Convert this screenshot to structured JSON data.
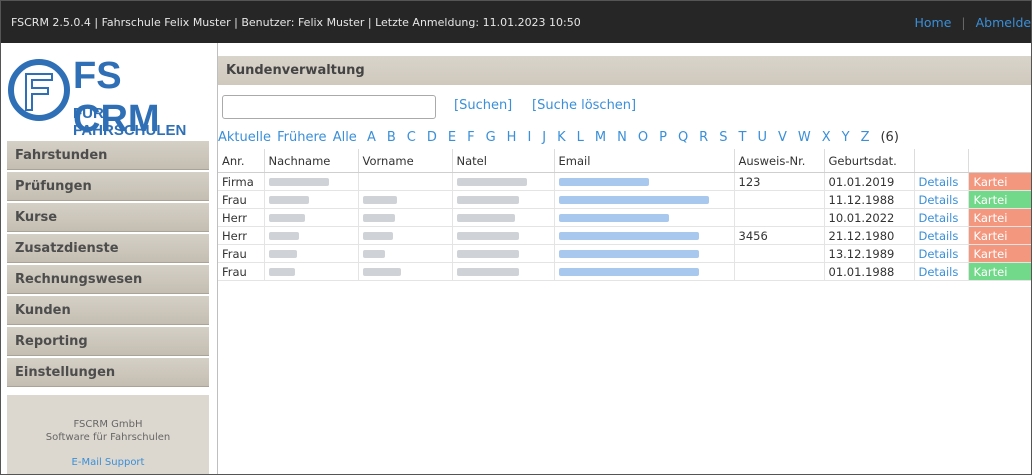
{
  "topbar": {
    "info": "FSCRM 2.5.0.4 | Fahrschule Felix Muster | Benutzer: Felix Muster | Letzte Anmeldung: 11.01.2023 10:50",
    "home": "Home",
    "logout": "Abmelden"
  },
  "logo": {
    "big": "FS CRM",
    "small": "FÜR FAHRSCHULEN",
    "colors": {
      "brand": "#2f6fb5"
    }
  },
  "nav": [
    "Fahrstunden",
    "Prüfungen",
    "Kurse",
    "Zusatzdienste",
    "Rechnungswesen",
    "Kunden",
    "Reporting",
    "Einstellungen"
  ],
  "footer": {
    "company": "FSCRM GmbH",
    "tagline": "Software für Fahrschulen",
    "support": "E-Mail Support"
  },
  "main": {
    "title": "Kundenverwaltung",
    "search": {
      "value": "",
      "placeholder": ""
    },
    "search_button": "[Suchen]",
    "clear_button": "[Suche löschen]",
    "filters": [
      "Aktuelle",
      "Frühere",
      "Alle"
    ],
    "letters": [
      "A",
      "B",
      "C",
      "D",
      "E",
      "F",
      "G",
      "H",
      "I",
      "J",
      "K",
      "L",
      "M",
      "N",
      "O",
      "P",
      "Q",
      "R",
      "S",
      "T",
      "U",
      "V",
      "W",
      "X",
      "Y",
      "Z"
    ],
    "count": "(6)"
  },
  "table": {
    "columns": [
      "Anr.",
      "Nachname",
      "Vorname",
      "Natel",
      "Email",
      "Ausweis-Nr.",
      "Geburtsdat.",
      "",
      ""
    ],
    "rows": [
      {
        "anr": "Firma",
        "ausweis": "123",
        "geburt": "01.01.2019",
        "details": "Details",
        "kartei": "Kartei",
        "kartei_status": "red"
      },
      {
        "anr": "Frau",
        "ausweis": "",
        "geburt": "11.12.1988",
        "details": "Details",
        "kartei": "Kartei",
        "kartei_status": "green"
      },
      {
        "anr": "Herr",
        "ausweis": "",
        "geburt": "10.01.2022",
        "details": "Details",
        "kartei": "Kartei",
        "kartei_status": "red"
      },
      {
        "anr": "Herr",
        "ausweis": "3456",
        "geburt": "21.12.1980",
        "details": "Details",
        "kartei": "Kartei",
        "kartei_status": "red"
      },
      {
        "anr": "Frau",
        "ausweis": "",
        "geburt": "13.12.1989",
        "details": "Details",
        "kartei": "Kartei",
        "kartei_status": "red"
      },
      {
        "anr": "Frau",
        "ausweis": "",
        "geburt": "01.01.1988",
        "details": "Details",
        "kartei": "Kartei",
        "kartei_status": "green"
      }
    ],
    "colors": {
      "kartei_red": "#f3977f",
      "kartei_green": "#72d88a",
      "link": "#3a8fd8"
    }
  }
}
